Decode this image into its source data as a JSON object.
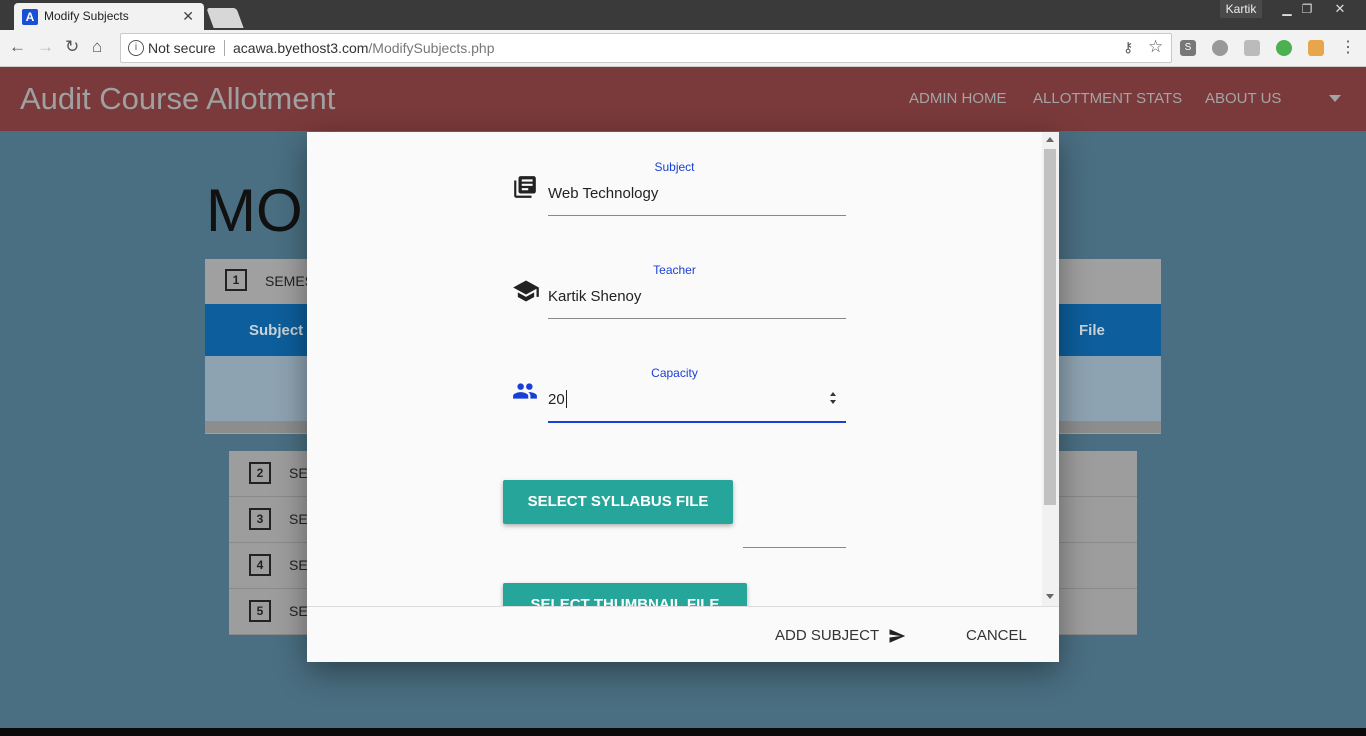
{
  "browser": {
    "tab_title": "Modify Subjects",
    "favicon_letter": "A",
    "tab_close": "✕",
    "profile_name": "Kartik",
    "security_label": "Not secure",
    "url_host": "acawa.byethost3.com",
    "url_path": "/ModifySubjects.php"
  },
  "app": {
    "brand": "Audit Course Allotment",
    "nav": [
      "ADMIN HOME",
      "ALLOTTMENT STATS",
      "ABOUT US"
    ]
  },
  "page": {
    "title_partial": "MO",
    "semester_rows": [
      {
        "num": "1",
        "label": "SEMES"
      },
      {
        "num": "2",
        "label": "SE"
      },
      {
        "num": "3",
        "label": "SE"
      },
      {
        "num": "4",
        "label": "SE"
      },
      {
        "num": "5",
        "label": "SE"
      }
    ],
    "table_headers": {
      "subject": "Subject",
      "file": "File"
    }
  },
  "dialog": {
    "subject": {
      "label": "Subject",
      "value": "Web Technology"
    },
    "teacher": {
      "label": "Teacher",
      "value": "Kartik Shenoy"
    },
    "capacity": {
      "label": "Capacity",
      "value": "20"
    },
    "select_syllabus": "SELECT SYLLABUS FILE",
    "select_thumbnail": "SELECT THUMBNAIL FILE",
    "add_subject": "ADD SUBJECT",
    "cancel": "CANCEL"
  },
  "icons": {
    "subject": "article-icon",
    "teacher": "graduation-cap-icon",
    "capacity": "people-icon",
    "add": "send-icon"
  },
  "colors": {
    "accent": "#1a3fd6",
    "teal_button": "#26a69a",
    "appbar": "#7a3a3c"
  }
}
